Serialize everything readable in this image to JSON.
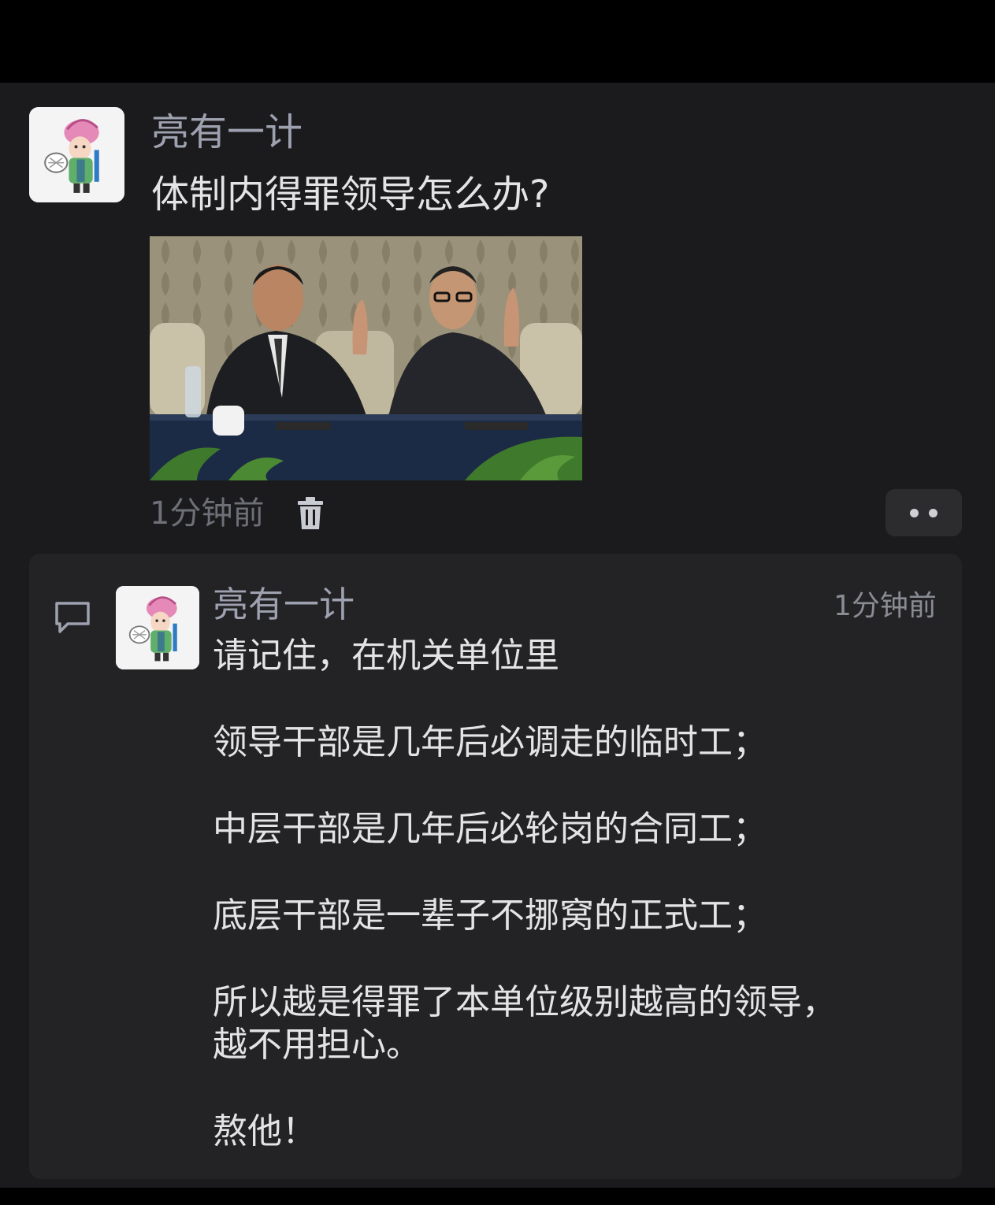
{
  "post": {
    "author": "亮有一计",
    "text": "体制内得罪领导怎么办?",
    "time": "1分钟前",
    "image_alt": "两位身穿西装的男子坐在会议桌后举手",
    "icons": {
      "delete": "trash-icon",
      "more": "more-dots-icon"
    }
  },
  "comment": {
    "author": "亮有一计",
    "time": "1分钟前",
    "icon": "comment-icon",
    "lines": [
      "请记住，在机关单位里",
      "领导干部是几年后必调走的临时工；",
      "中层干部是几年后必轮岗的合同工；",
      "底层干部是一辈子不挪窝的正式工；",
      "所以越是得罪了本单位级别越高的领导，",
      "越不用担心。",
      "熬他！"
    ]
  },
  "colors": {
    "background": "#1b1b1d",
    "comment_background": "#232325",
    "author_text": "#9ea2b0",
    "body_text": "#e4e4e6",
    "muted_text": "#6e7078"
  }
}
